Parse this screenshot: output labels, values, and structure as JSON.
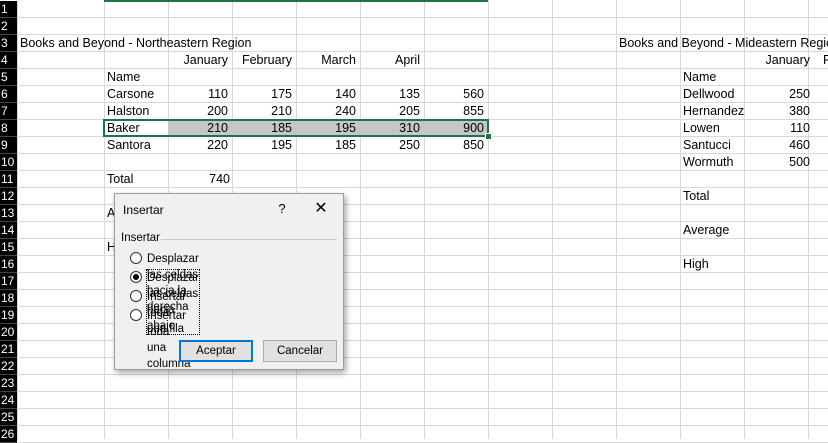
{
  "sheet": {
    "row_numbers": [
      "1",
      "2",
      "3",
      "4",
      "5",
      "6",
      "7",
      "8",
      "9",
      "10",
      "11",
      "12",
      "13",
      "14",
      "15",
      "16",
      "17",
      "18",
      "19",
      "20",
      "21",
      "22",
      "23",
      "24",
      "25",
      "26"
    ],
    "left_title": "Books and Beyond - Northeastern Region",
    "right_title": "Books and Beyond - Mideastern Region",
    "left_months": [
      "January",
      "February",
      "March",
      "April"
    ],
    "name_header": "Name",
    "left_rows": [
      {
        "name": "Carsone",
        "values": [
          "110",
          "175",
          "140",
          "135",
          "560"
        ]
      },
      {
        "name": "Halston",
        "values": [
          "200",
          "210",
          "240",
          "205",
          "855"
        ]
      },
      {
        "name": "Baker",
        "values": [
          "210",
          "185",
          "195",
          "310",
          "900"
        ]
      },
      {
        "name": "Santora",
        "values": [
          "220",
          "195",
          "185",
          "250",
          "850"
        ]
      }
    ],
    "left_total_label": "Total",
    "left_total_value": "740",
    "partial_a": "A",
    "partial_h": "H",
    "right_month": "January",
    "right_month_partial": "F",
    "right_rows": [
      {
        "name": "Dellwood",
        "value": "250"
      },
      {
        "name": "Hernandez",
        "value": "380"
      },
      {
        "name": "Lowen",
        "value": "110"
      },
      {
        "name": "Santucci",
        "value": "460"
      },
      {
        "name": "Wormuth",
        "value": "500"
      }
    ],
    "right_total_label": "Total",
    "right_average_label": "Average",
    "right_high_label": "High"
  },
  "dialog": {
    "title": "Insertar",
    "help": "?",
    "close": "✕",
    "group_label": "Insertar",
    "options": [
      {
        "label": "Desplazar las celdas hacia la derecha",
        "selected": false
      },
      {
        "label": "Desplazar las celdas hacia abajo",
        "selected": true
      },
      {
        "label": "Insertar toda una fila",
        "selected": false
      },
      {
        "label": "Insertar toda una columna",
        "selected": false
      }
    ],
    "ok_label": "Aceptar",
    "cancel_label": "Cancelar"
  }
}
